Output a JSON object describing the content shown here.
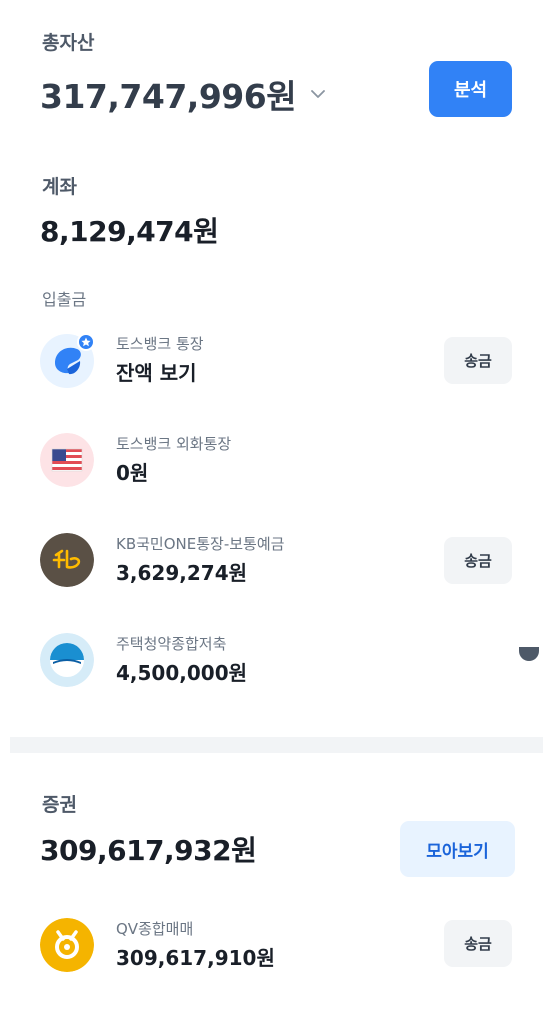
{
  "total": {
    "label": "총자산",
    "amount": "317,747,996원",
    "analyze_label": "분석"
  },
  "accounts_section": {
    "title": "계좌",
    "amount": "8,129,474원",
    "sub_label": "입출금"
  },
  "accounts": [
    {
      "name": "토스뱅크 통장",
      "amount": "잔액 보기",
      "icon": "toss-bank-icon",
      "send_label": "송금"
    },
    {
      "name": "토스뱅크 외화통장",
      "amount": "0원",
      "icon": "us-flag-icon"
    },
    {
      "name": "KB국민ONE통장-보통예금",
      "amount": "3,629,274원",
      "icon": "kb-bank-icon",
      "send_label": "송금"
    },
    {
      "name": "주택청약종합저축",
      "amount": "4,500,000원",
      "icon": "housing-subscription-icon"
    }
  ],
  "securities": {
    "title": "증권",
    "amount": "309,617,932원",
    "collect_label": "모아보기",
    "account": {
      "name": "QV종합매매",
      "amount": "309,617,910원",
      "icon": "qv-securities-icon",
      "send_label": "송금"
    }
  },
  "colors": {
    "accent": "#3182f6",
    "collect_bg": "#e8f3ff",
    "button_bg": "#f2f4f6"
  }
}
